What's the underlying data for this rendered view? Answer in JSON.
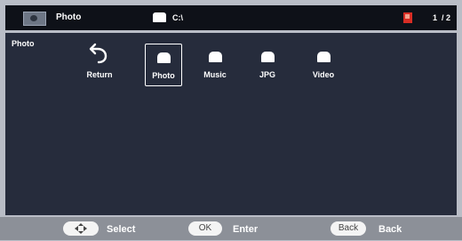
{
  "header": {
    "title": "Photo",
    "path": "C:\\",
    "page": "1  / 2"
  },
  "content": {
    "section_label": "Photo",
    "items": [
      {
        "label": "Return",
        "icon": "return-arrow-icon"
      },
      {
        "label": "Photo",
        "icon": "folder-icon",
        "selected": true
      },
      {
        "label": "Music",
        "icon": "folder-icon"
      },
      {
        "label": "JPG",
        "icon": "folder-icon"
      },
      {
        "label": "Video",
        "icon": "folder-icon"
      }
    ]
  },
  "footer": {
    "select_label": "Select",
    "ok_key": "OK",
    "enter_label": "Enter",
    "back_key": "Back",
    "back_label": "Back"
  },
  "colors": {
    "frame": "#b9bdc6",
    "topbar": "#0e1118",
    "panel": "#262c3c",
    "bottombar": "#8c9098",
    "page_icon": "#d82d24"
  }
}
